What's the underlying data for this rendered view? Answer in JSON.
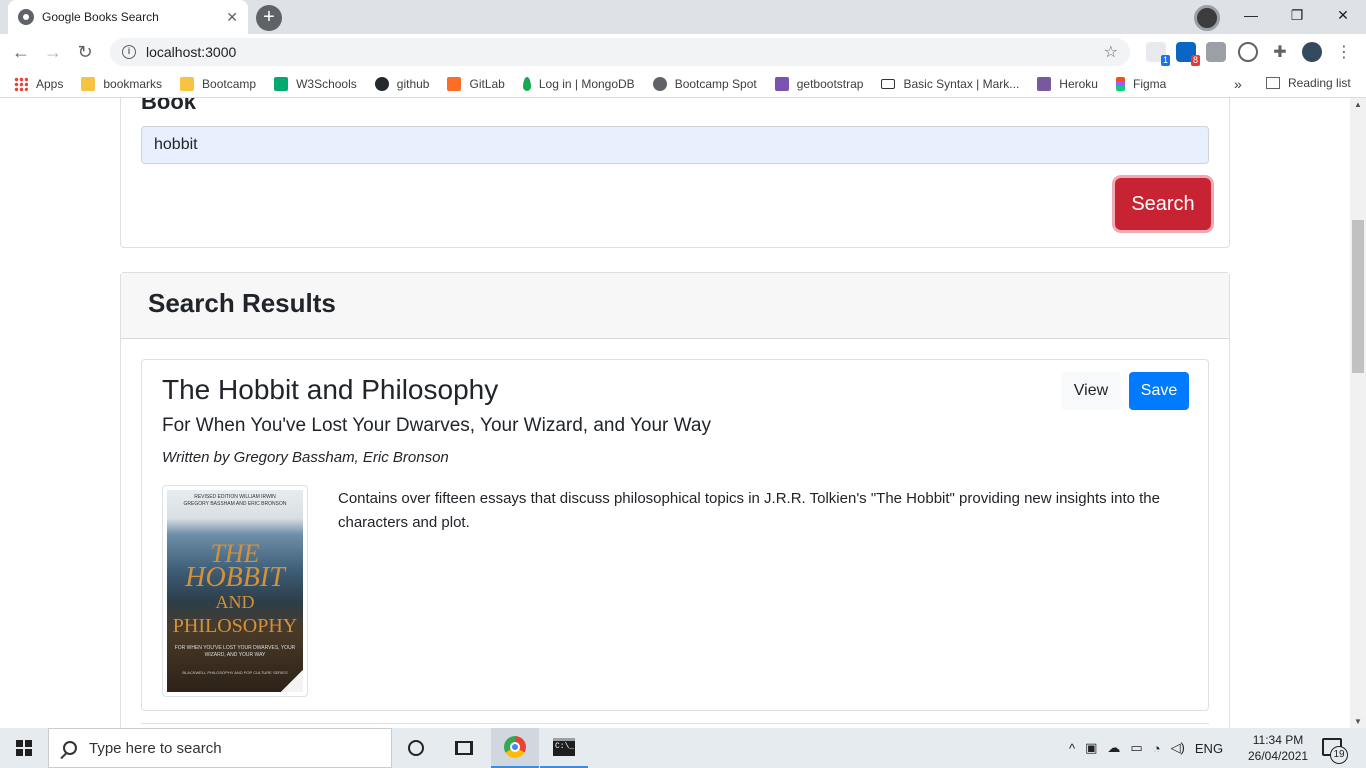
{
  "browser": {
    "tab_title": "Google Books Search",
    "tab_close": "✕",
    "new_tab": "+",
    "url": "localhost:3000",
    "window_controls": {
      "minimize": "—",
      "restore": "❐",
      "close": "✕"
    },
    "extension_badges": {
      "first": "1",
      "linkedin": "8"
    },
    "bookmarks": [
      {
        "label": "Apps",
        "icon": "apps-icon"
      },
      {
        "label": "bookmarks",
        "icon": "folder-icon"
      },
      {
        "label": "Bootcamp",
        "icon": "folder-icon"
      },
      {
        "label": "W3Schools",
        "icon": "w3schools-icon"
      },
      {
        "label": "github",
        "icon": "github-icon"
      },
      {
        "label": "GitLab",
        "icon": "gitlab-icon"
      },
      {
        "label": "Log in | MongoDB",
        "icon": "mongodb-icon"
      },
      {
        "label": "Bootcamp Spot",
        "icon": "globe-icon"
      },
      {
        "label": "getbootstrap",
        "icon": "bootstrap-icon"
      },
      {
        "label": "Basic Syntax | Mark...",
        "icon": "markdown-icon"
      },
      {
        "label": "Heroku",
        "icon": "heroku-icon"
      },
      {
        "label": "Figma",
        "icon": "figma-icon"
      }
    ],
    "bookmarks_more": "»",
    "reading_list": "Reading list"
  },
  "page": {
    "search": {
      "label": "Book",
      "value": "hobbit",
      "button": "Search"
    },
    "results": {
      "heading": "Search Results",
      "items": [
        {
          "title": "The Hobbit and Philosophy",
          "subtitle": "For When You've Lost Your Dwarves, Your Wizard, and Your Way",
          "authors": "Written by Gregory Bassham, Eric Bronson",
          "description": "Contains over fifteen essays that discuss philosophical topics in J.R.R. Tolkien's \"The Hobbit\" providing new insights into the characters and plot.",
          "view_label": "View",
          "save_label": "Save",
          "cover": {
            "top_line_1": "REVISED EDITION   WILLIAM IRWIN",
            "top_line_2": "GREGORY BASSHAM AND ERIC BRONSON",
            "title_1": "THE",
            "title_2": "HOBBIT",
            "title_3": "AND",
            "title_4": "PHILOSOPHY",
            "subtitle": "FOR WHEN YOU'VE LOST YOUR DWARVES, YOUR WIZARD, AND YOUR WAY",
            "series": "BLACKWELL PHILOSOPHY AND POP CULTURE SERIES"
          }
        }
      ]
    }
  },
  "taskbar": {
    "search_placeholder": "Type here to search",
    "language": "ENG",
    "time": "11:34 PM",
    "date": "26/04/2021",
    "notifications": "19"
  }
}
